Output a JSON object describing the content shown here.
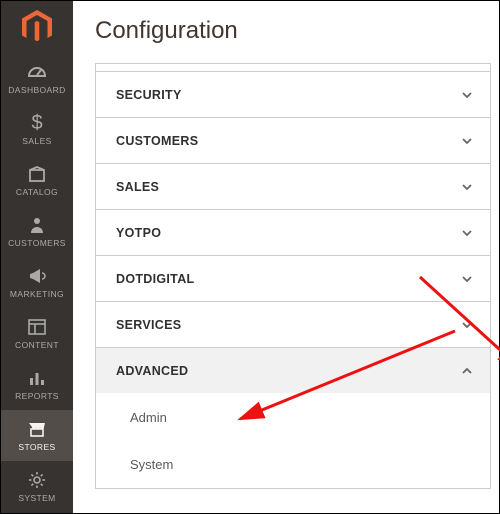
{
  "brand": {
    "name": "Magento"
  },
  "page": {
    "title": "Configuration"
  },
  "sidebar": {
    "items": [
      {
        "id": "dashboard",
        "label": "DASHBOARD"
      },
      {
        "id": "sales",
        "label": "SALES"
      },
      {
        "id": "catalog",
        "label": "CATALOG"
      },
      {
        "id": "customers",
        "label": "CUSTOMERS"
      },
      {
        "id": "marketing",
        "label": "MARKETING"
      },
      {
        "id": "content",
        "label": "CONTENT"
      },
      {
        "id": "reports",
        "label": "REPORTS"
      },
      {
        "id": "stores",
        "label": "STORES",
        "active": true
      },
      {
        "id": "system",
        "label": "SYSTEM"
      }
    ]
  },
  "config": {
    "sections": [
      {
        "id": "security",
        "label": "SECURITY",
        "expanded": false
      },
      {
        "id": "customers",
        "label": "CUSTOMERS",
        "expanded": false
      },
      {
        "id": "sales",
        "label": "SALES",
        "expanded": false
      },
      {
        "id": "yotpo",
        "label": "YOTPO",
        "expanded": false
      },
      {
        "id": "dotdigital",
        "label": "DOTDIGITAL",
        "expanded": false
      },
      {
        "id": "services",
        "label": "SERVICES",
        "expanded": false
      },
      {
        "id": "advanced",
        "label": "ADVANCED",
        "expanded": true,
        "children": [
          {
            "id": "admin",
            "label": "Admin"
          },
          {
            "id": "system",
            "label": "System"
          }
        ]
      }
    ]
  }
}
